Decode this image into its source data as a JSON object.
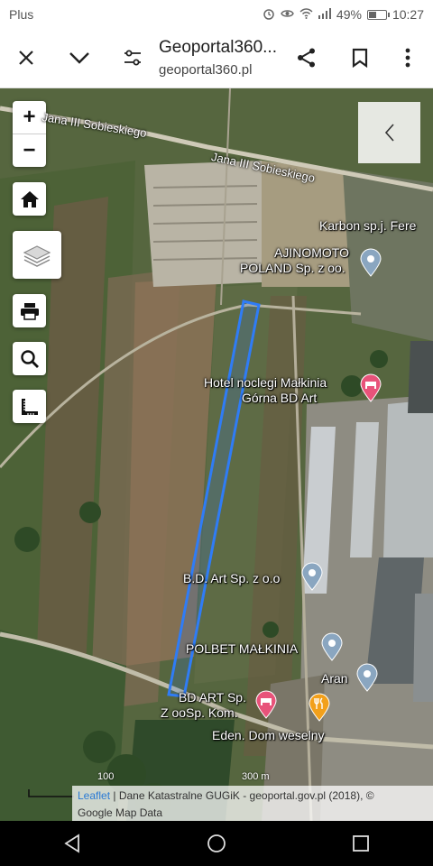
{
  "status": {
    "carrier": "Plus",
    "battery_text": "49%",
    "battery_level": 0.49,
    "time": "10:27",
    "icons": [
      "alarm-icon",
      "eye-icon",
      "wifi-icon",
      "signal-icon",
      "battery-icon"
    ]
  },
  "browser": {
    "title": "Geoportal360...",
    "url": "geoportal360.pl",
    "icons": [
      "close-icon",
      "chevron-down-icon",
      "settings-sliders-icon",
      "share-icon",
      "bookmark-icon",
      "more-vert-icon"
    ]
  },
  "map": {
    "zoom_in": "+",
    "zoom_out": "−",
    "tool_icons": [
      "home-icon",
      "layers-icon",
      "print-icon",
      "search-icon",
      "measure-icon"
    ],
    "panel_toggle_icon": "chevron-left-icon",
    "streets": [
      "Jana III Sobieskiego",
      "Jana III Sobieskiego"
    ],
    "places": [
      {
        "name": "Karbon sp.j. Fere",
        "icon": "location-pin-icon"
      },
      {
        "name": "AJINOMOTO",
        "name2": "POLAND Sp. z oo.",
        "icon": "location-pin-icon"
      },
      {
        "name": "Hotel noclegi Małkinia",
        "name2": "Górna BD Art",
        "icon": "hotel-pin-icon"
      },
      {
        "name": "B.D. Art Sp. z o.o",
        "icon": "location-pin-icon"
      },
      {
        "name": "POLBET MAŁKINIA",
        "icon": "location-pin-icon"
      },
      {
        "name": "Aran",
        "icon": "location-pin-icon"
      },
      {
        "name": "BD ART Sp.",
        "name2": "Z ooSp. Kom.",
        "icon": "hotel-pin-icon"
      },
      {
        "name": "Eden. Dom weselny",
        "icon": "restaurant-pin-icon"
      }
    ],
    "scale_labels": [
      "100",
      "300 m"
    ],
    "attribution": {
      "link": "Leaflet",
      "text": " | Dane Katastralne GUGiK - geoportal.gov.pl (2018), ©",
      "line2": "Google Map Data"
    },
    "colors": {
      "parcel_outline": "#2f7cf6",
      "pin": "#8aa6c0",
      "hotel_pin": "#e8537a",
      "restaurant_pin": "#f2a01b"
    }
  },
  "navbar": {
    "icons": [
      "back-icon",
      "home-circle-icon",
      "recents-icon"
    ]
  }
}
